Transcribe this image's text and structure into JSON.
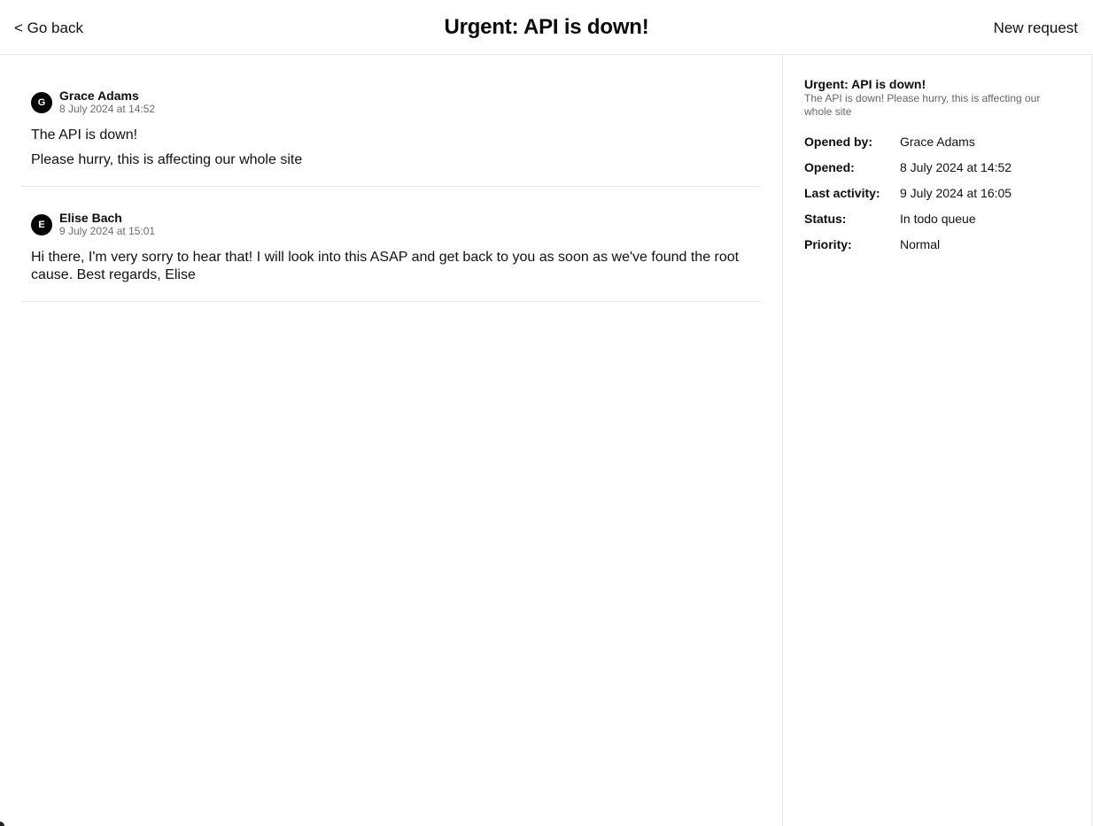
{
  "header": {
    "back_label": "< Go back",
    "title": "Urgent: API is down!",
    "new_request_label": "New request"
  },
  "messages": [
    {
      "initial": "G",
      "author": "Grace Adams",
      "timestamp": "8 July 2024 at 14:52",
      "lines": [
        "The API is down!",
        "Please hurry, this is affecting our whole site"
      ]
    },
    {
      "initial": "E",
      "author": "Elise Bach",
      "timestamp": "9 July 2024 at 15:01",
      "lines": [
        "Hi there, I'm very sorry to hear that! I will look into this ASAP and get back to you as soon as we've found the root cause. Best regards, Elise"
      ]
    }
  ],
  "sidebar": {
    "title": "Urgent: API is down!",
    "description": "The API is down! Please hurry, this is affecting our whole site",
    "details": [
      {
        "label": "Opened by:",
        "value": "Grace Adams"
      },
      {
        "label": "Opened:",
        "value": "8 July 2024 at 14:52"
      },
      {
        "label": "Last activity:",
        "value": "9 July 2024 at 16:05"
      },
      {
        "label": "Status:",
        "value": "In todo queue"
      },
      {
        "label": "Priority:",
        "value": "Normal"
      }
    ]
  }
}
